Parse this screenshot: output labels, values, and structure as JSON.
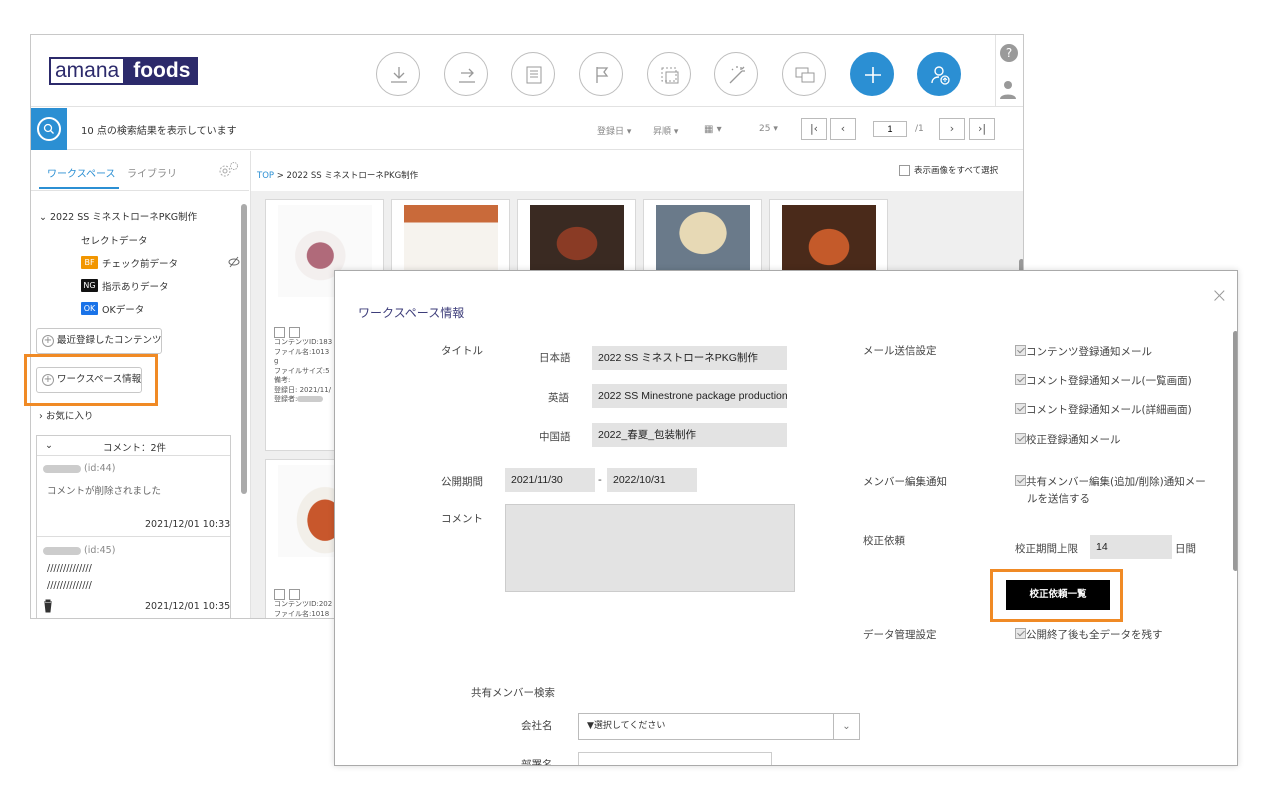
{
  "header": {
    "logo_left": "amana",
    "logo_right": "foods",
    "toolbar_icons": [
      "download-icon",
      "move-icon",
      "document-icon",
      "flag-icon",
      "crop-icon",
      "magic-wand-icon",
      "monitor-icon",
      "add-icon",
      "user-upload-icon"
    ],
    "help_label": "?"
  },
  "search": {
    "result_text": "10 点の検索結果を表示しています",
    "sort": "登録日",
    "order": "昇順",
    "per_page": "25",
    "page": "1",
    "page_total": "/1"
  },
  "left": {
    "tabs": [
      "ワークスペース",
      "ライブラリ"
    ],
    "folder": "2022 SS ミネストローネPKG制作",
    "select_data": "セレクトデータ",
    "items": [
      {
        "badge": "BF",
        "label": "チェック前データ",
        "color": "#f29600"
      },
      {
        "badge": "NG",
        "label": "指示ありデータ",
        "color": "#111111"
      },
      {
        "badge": "OK",
        "label": "OKデータ",
        "color": "#1a73e8"
      }
    ],
    "recent": "最近登録したコンテンツ",
    "ws_info": "ワークスペース情報",
    "favorites": "お気に入り",
    "comments_header": "コメント：2件",
    "comments": [
      {
        "id": "(id:44)",
        "text": "コメントが削除されました",
        "date": "2021/12/01 10:33"
      },
      {
        "id": "(id:45)",
        "text": "//////////////",
        "text2": "//////////////",
        "date": "2021/12/01 10:35"
      }
    ]
  },
  "main": {
    "crumb_top": "TOP",
    "crumb_sep": ">",
    "crumb_current": "2022 SS ミネストローネPKG制作",
    "select_all": "表示画像をすべて選択",
    "meta1": [
      "コンテンツID:183",
      "ファイル名:1013",
      "g",
      "ファイルサイズ:5",
      "備考:",
      "登録日: 2021/11/",
      "登録者:"
    ],
    "meta2": [
      "コンテンツID:202",
      "ファイル名:1018"
    ]
  },
  "modal": {
    "title": "ワークスペース情報",
    "close": "×",
    "title_label": "タイトル",
    "ja_label": "日本語",
    "ja_value": "2022 SS ミネストローネPKG制作",
    "en_label": "英語",
    "en_value": "2022 SS Minestrone package production",
    "zh_label": "中国語",
    "zh_value": "2022_春夏_包装制作",
    "period_label": "公開期間",
    "period_start": "2021/11/30",
    "period_sep": "-",
    "period_end": "2022/10/31",
    "comment_label": "コメント",
    "mail_label": "メール送信設定",
    "mail_options": [
      "コンテンツ登録通知メール",
      "コメント登録通知メール(一覧画面)",
      "コメント登録通知メール(詳細画面)",
      "校正登録通知メール"
    ],
    "member_label": "メンバー編集通知",
    "member_option_1": "共有メンバー編集(追加/削除)通知メー",
    "member_option_2": "ルを送信する",
    "proof_label": "校正依頼",
    "proof_limit_label": "校正期間上限",
    "proof_limit": "14",
    "proof_unit": "日間",
    "proof_button": "校正依頼一覧",
    "data_label": "データ管理設定",
    "data_option": "公開終了後も全データを残す",
    "share_label": "共有メンバー検索",
    "company_label": "会社名",
    "company_select": "▼選択してください",
    "dept_label": "部署名"
  },
  "colors": {
    "accent": "#2b8fd3",
    "highlight": "#f08a25",
    "logo": "#2c2a6b"
  }
}
